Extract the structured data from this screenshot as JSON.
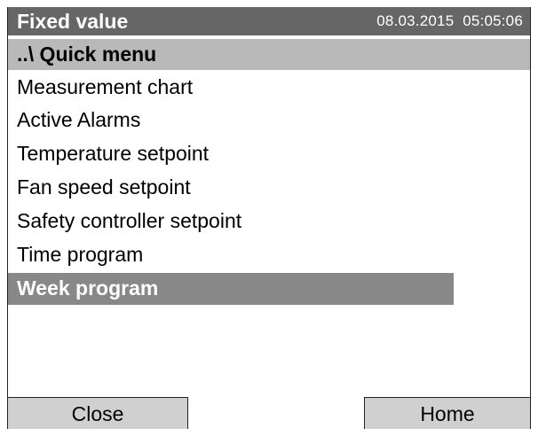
{
  "title_bar": {
    "title": "Fixed value",
    "date": "08.03.2015",
    "time": "05:05:06"
  },
  "path": {
    "label": "..\\ Quick menu"
  },
  "menu": {
    "items": [
      {
        "label": "Measurement chart"
      },
      {
        "label": "Active Alarms"
      },
      {
        "label": "Temperature setpoint"
      },
      {
        "label": "Fan speed setpoint"
      },
      {
        "label": "Safety controller setpoint"
      },
      {
        "label": "Time program"
      },
      {
        "label": "Week program",
        "selected": true
      }
    ]
  },
  "footer": {
    "close_label": "Close",
    "home_label": "Home"
  },
  "colors": {
    "title_bg": "#666666",
    "path_bg": "#b9b9b9",
    "selected_bg": "#888888",
    "button_bg": "#d0d0d0"
  }
}
